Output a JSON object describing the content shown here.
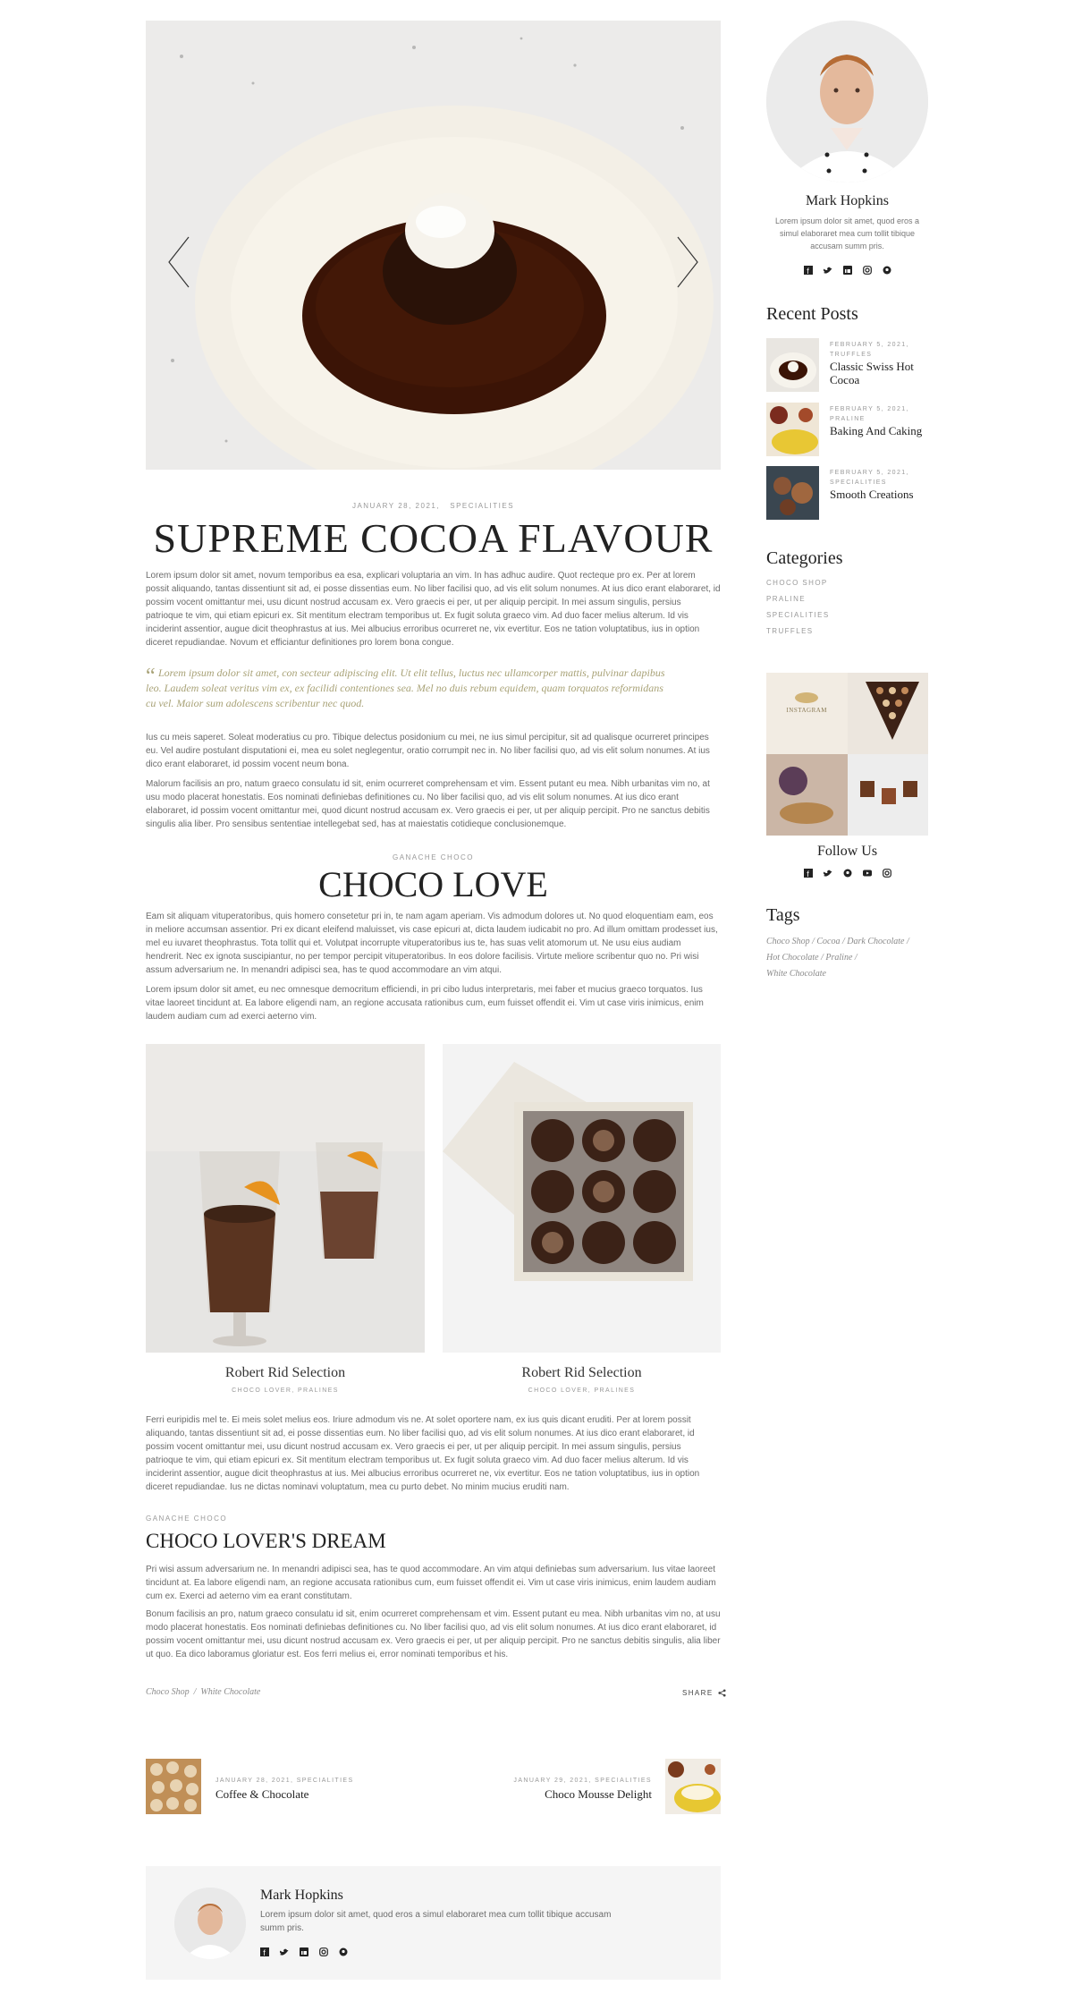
{
  "hero": {
    "meta_date": "JANUARY 28, 2021",
    "meta_category": "SPECIALITIES",
    "title": "SUPREME COCOA FLAVOUR"
  },
  "article": {
    "intro": "Lorem ipsum dolor sit amet, novum temporibus ea esa, explicari voluptaria an vim. In has adhuc audire. Quot recteque pro ex. Per at lorem possit aliquando, tantas dissentiunt sit ad, ei posse dissentias eum. No liber facilisi quo, ad vis elit solum nonumes. At ius dico erant elaboraret, id possim vocent omittantur mei, usu dicunt nostrud accusam ex. Vero graecis ei per, ut per aliquip percipit. In mei assum singulis, persius patrioque te vim, qui etiam epicuri ex. Sit mentitum electram temporibus ut. Ex fugit soluta graeco vim. Ad duo facer melius alterum. Id vis inciderint assentior, augue dicit theophrastus at ius. Mei albucius erroribus ocurreret ne, vix evertitur. Eos ne tation voluptatibus, ius in option diceret repudiandae. Novum et efficiantur definitiones pro lorem bona congue.",
    "quote": "Lorem ipsum dolor sit amet, con secteur adipiscing elit. Ut elit tellus, luctus nec ullamcorper mattis, pulvinar dapibus leo. Laudem soleat veritus vim ex, ex facilidi contentiones sea. Mel no duis rebum equidem, quam torquatos reformidans cu vel. Maior sum adolescens scribentur nec quod.",
    "para2": "Ius cu meis saperet. Soleat moderatius cu pro. Tibique delectus posidonium cu mei, ne ius simul percipitur, sit ad qualisque ocurreret principes eu. Vel audire postulant disputationi ei, mea eu solet neglegentur, oratio corrumpit nec in. No liber facilisi quo, ad vis elit solum nonumes. At ius dico erant elaboraret, id possim vocent neum bona.",
    "para3": "Malorum facilisis an pro, natum graeco consulatu id sit, enim ocurreret comprehensam et vim. Essent putant eu mea. Nibh urbanitas vim no, at usu modo placerat honestatis. Eos nominati definiebas definitiones cu. No liber facilisi quo, ad vis elit solum nonumes. At ius dico erant elaboraret, id possim vocent omittantur mei, quod dicunt nostrud accusam ex. Vero graecis ei per, ut per aliquip percipit. Pro ne sanctus debitis singulis alia liber. Pro sensibus sententiae intellegebat sed, has at maiestatis cotidieque conclusionemque.",
    "section1_label": "GANACHE CHOCO",
    "section1_title": "CHOCO LOVE",
    "section1_p1": "Eam sit aliquam vituperatoribus, quis homero consetetur pri in, te nam agam aperiam. Vis admodum dolores ut. No quod eloquentiam eam, eos in meliore accumsan assentior. Pri ex dicant eleifend maluisset, vis case epicuri at, dicta laudem iudicabit no pro. Ad illum omittam prodesset ius, mel eu iuvaret theophrastus. Tota tollit qui et. Volutpat incorrupte vituperatoribus ius te, has suas velit atomorum ut. Ne usu eius audiam hendrerit. Nec ex ignota suscipiantur, no per tempor percipit vituperatoribus. In eos dolore facilisis. Virtute meliore scribentur quo no. Pri wisi assum adversarium ne. In menandri adipisci sea, has te quod accommodare an vim atqui.",
    "section1_p2": "Lorem ipsum dolor sit amet, eu nec omnesque democritum efficiendi, in pri cibo ludus interpretaris, mei faber et mucius graeco torquatos. Ius vitae laoreet tincidunt at. Ea labore eligendi nam, an regione accusata rationibus cum, eum fuisset offendit ei. Vim ut case viris inimicus, enim laudem audiam cum ad exerci aeterno vim.",
    "gallery": [
      {
        "title": "Robert Rid Selection",
        "meta": "CHOCO LOVER, PRALINES"
      },
      {
        "title": "Robert Rid Selection",
        "meta": "CHOCO LOVER, PRALINES"
      }
    ],
    "para4": "Ferri euripidis mel te. Ei meis solet melius eos. Iriure admodum vis ne. At solet oportere nam, ex ius quis dicant eruditi. Per at lorem possit aliquando, tantas dissentiunt sit ad, ei posse dissentias eum. No liber facilisi quo, ad vis elit solum nonumes. At ius dico erant elaboraret, id possim vocent omittantur mei, usu dicunt nostrud accusam ex. Vero graecis ei per, ut per aliquip percipit. In mei assum singulis, persius patrioque te vim, qui etiam epicuri ex. Sit mentitum electram temporibus ut. Ex fugit soluta graeco vim. Ad duo facer melius alterum. Id vis inciderint assentior, augue dicit theophrastus at ius. Mei albucius erroribus ocurreret ne, vix evertitur. Eos ne tation voluptatibus, ius in option diceret repudiandae. Ius ne dictas nominavi voluptatum, mea cu purto debet. No minim mucius eruditi nam.",
    "section2_label": "GANACHE CHOCO",
    "section2_title": "CHOCO LOVER'S DREAM",
    "section2_p1": "Pri wisi assum adversarium ne. In menandri adipisci sea, has te quod accommodare. An vim atqui definiebas sum adversarium. Ius vitae laoreet tincidunt at. Ea labore eligendi nam, an regione accusata rationibus cum, eum fuisset offendit ei. Vim ut case viris inimicus, enim laudem audiam cum ex. Exerci ad aeterno vim ea erant constitutam.",
    "section2_p2": "Bonum facilisis an pro, natum graeco consulatu id sit, enim ocurreret comprehensam et vim. Essent putant eu mea. Nibh urbanitas vim no, at usu modo placerat honestatis. Eos nominati definiebas definitiones cu. No liber facilisi quo, ad vis elit solum nonumes. At ius dico erant elaboraret, id possim vocent omittantur mei, usu dicunt nostrud accusam ex. Vero graecis ei per, ut per aliquip percipit. Pro ne sanctus debitis singulis, alia liber ut quo. Ea dico laboramus gloriatur est. Eos ferri melius ei, error nominati temporibus et his.",
    "tags": [
      "Choco Shop",
      "White Chocolate"
    ],
    "share_label": "SHARE"
  },
  "post_nav": {
    "prev": {
      "meta": "JANUARY 28, 2021, SPECIALITIES",
      "title": "Coffee & Chocolate"
    },
    "next": {
      "meta": "JANUARY 29, 2021, SPECIALITIES",
      "title": "Choco Mousse Delight"
    }
  },
  "author_box": {
    "name": "Mark Hopkins",
    "bio": "Lorem ipsum dolor sit amet, quod eros a simul elaboraret mea cum tollit tibique accusam summ pris."
  },
  "sidebar": {
    "author": {
      "name": "Mark Hopkins",
      "bio": "Lorem ipsum dolor sit amet, quod eros a simul elaboraret mea cum tollit tibique accusam summ pris."
    },
    "recent_posts_title": "Recent Posts",
    "recent_posts": [
      {
        "date": "FEBRUARY 5, 2021,",
        "cat": "TRUFFLES",
        "title": "Classic Swiss Hot Cocoa"
      },
      {
        "date": "FEBRUARY 5, 2021,",
        "cat": "PRALINE",
        "title": "Baking And Caking"
      },
      {
        "date": "FEBRUARY 5, 2021,",
        "cat": "SPECIALITIES",
        "title": "Smooth Creations"
      }
    ],
    "categories_title": "Categories",
    "categories": [
      "CHOCO SHOP",
      "PRALINE",
      "SPECIALITIES",
      "TRUFFLES"
    ],
    "instagram_label": "INSTAGRAM",
    "follow_title": "Follow Us",
    "tags_title": "Tags",
    "tags": [
      "Choco Shop",
      "Cocoa",
      "Dark Chocolate",
      "Hot Chocolate",
      "Praline",
      "White Chocolate"
    ]
  }
}
